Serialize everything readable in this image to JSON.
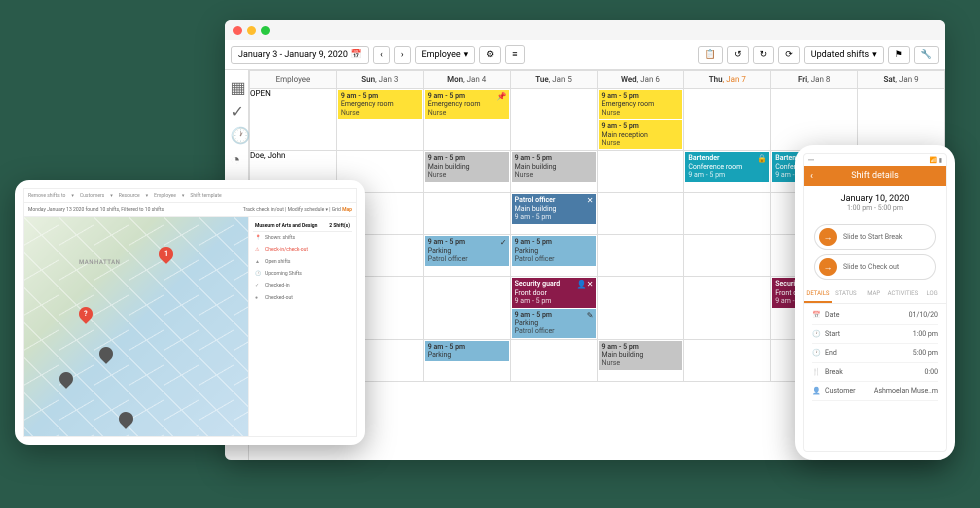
{
  "browser": {
    "date_range": "January 3 - January 9, 2020",
    "view_selector": "Employee",
    "filter": "Updated shifts",
    "days": [
      {
        "dow": "Sun",
        "day": "Jan 3"
      },
      {
        "dow": "Mon",
        "day": "Jan 4"
      },
      {
        "dow": "Tue",
        "day": "Jan 5"
      },
      {
        "dow": "Wed",
        "day": "Jan 6"
      },
      {
        "dow": "Thu",
        "day": "Jan 7"
      },
      {
        "dow": "Fri",
        "day": "Jan 8"
      },
      {
        "dow": "Sat",
        "day": "Jan 9"
      }
    ],
    "emp_header": "Employee",
    "rows": [
      {
        "name": "OPEN"
      },
      {
        "name": "Doe, John"
      }
    ],
    "shifts": {
      "er": {
        "time": "9 am - 5 pm",
        "title": "Emergency room",
        "sub": "Nurse"
      },
      "mr": {
        "time": "9 am - 5 pm",
        "title": "Main reception",
        "sub": "Nurse"
      },
      "mb": {
        "time": "9 am - 5 pm",
        "title": "Main building",
        "sub": "Nurse"
      },
      "bart": {
        "time": "",
        "title": "Bartender",
        "sub": "Conference room",
        "time2": "9 am - 5 pm"
      },
      "patrol": {
        "time": "",
        "title": "Patrol officer",
        "sub": "Main building",
        "time2": "9 am - 5 pm"
      },
      "park": {
        "time": "9 am - 5 pm",
        "title": "Parking",
        "sub": "Patrol officer"
      },
      "sec": {
        "time": "",
        "title": "Security guard",
        "sub": "Front door",
        "time2": "9 am - 5 pm"
      }
    }
  },
  "tablet": {
    "top_items": [
      "Remove shifts to",
      "Customers",
      "Resource",
      "Employee",
      "Shift template"
    ],
    "date_line": "Monday January 13 2020 found 10 shifts, Filtered to 10 shifts",
    "tools": [
      "Track check in/out",
      "Modify schedule",
      "Grid",
      "Map"
    ],
    "panel_title": "Museum of Arts and Design",
    "panel_count": "2 Shift(s)",
    "panel_items": [
      {
        "label": "Shown: shifts",
        "class": ""
      },
      {
        "label": "Check-in/check-out",
        "class": "red"
      },
      {
        "label": "Open shifts",
        "class": ""
      },
      {
        "label": "Upcoming Shifts",
        "class": ""
      },
      {
        "label": "Checked-in",
        "class": ""
      },
      {
        "label": "Checked-out",
        "class": ""
      }
    ],
    "map_label": "MANHATTAN"
  },
  "phone": {
    "header": "Shift details",
    "date": "January 10, 2020",
    "time": "1:00 pm - 5:00 pm",
    "slide1": "Slide to Start Break",
    "slide2": "Slide to Check out",
    "tabs": [
      "DETAILS",
      "STATUS",
      "MAP",
      "ACTIVITIES",
      "LOG"
    ],
    "details": [
      {
        "icon": "📅",
        "label": "Date",
        "value": "01/10/20"
      },
      {
        "icon": "🕐",
        "label": "Start",
        "value": "1:00 pm"
      },
      {
        "icon": "🕐",
        "label": "End",
        "value": "5:00 pm"
      },
      {
        "icon": "🍴",
        "label": "Break",
        "value": "0:00"
      },
      {
        "icon": "👤",
        "label": "Customer",
        "value": "Ashmoelan Muse..m"
      }
    ]
  }
}
